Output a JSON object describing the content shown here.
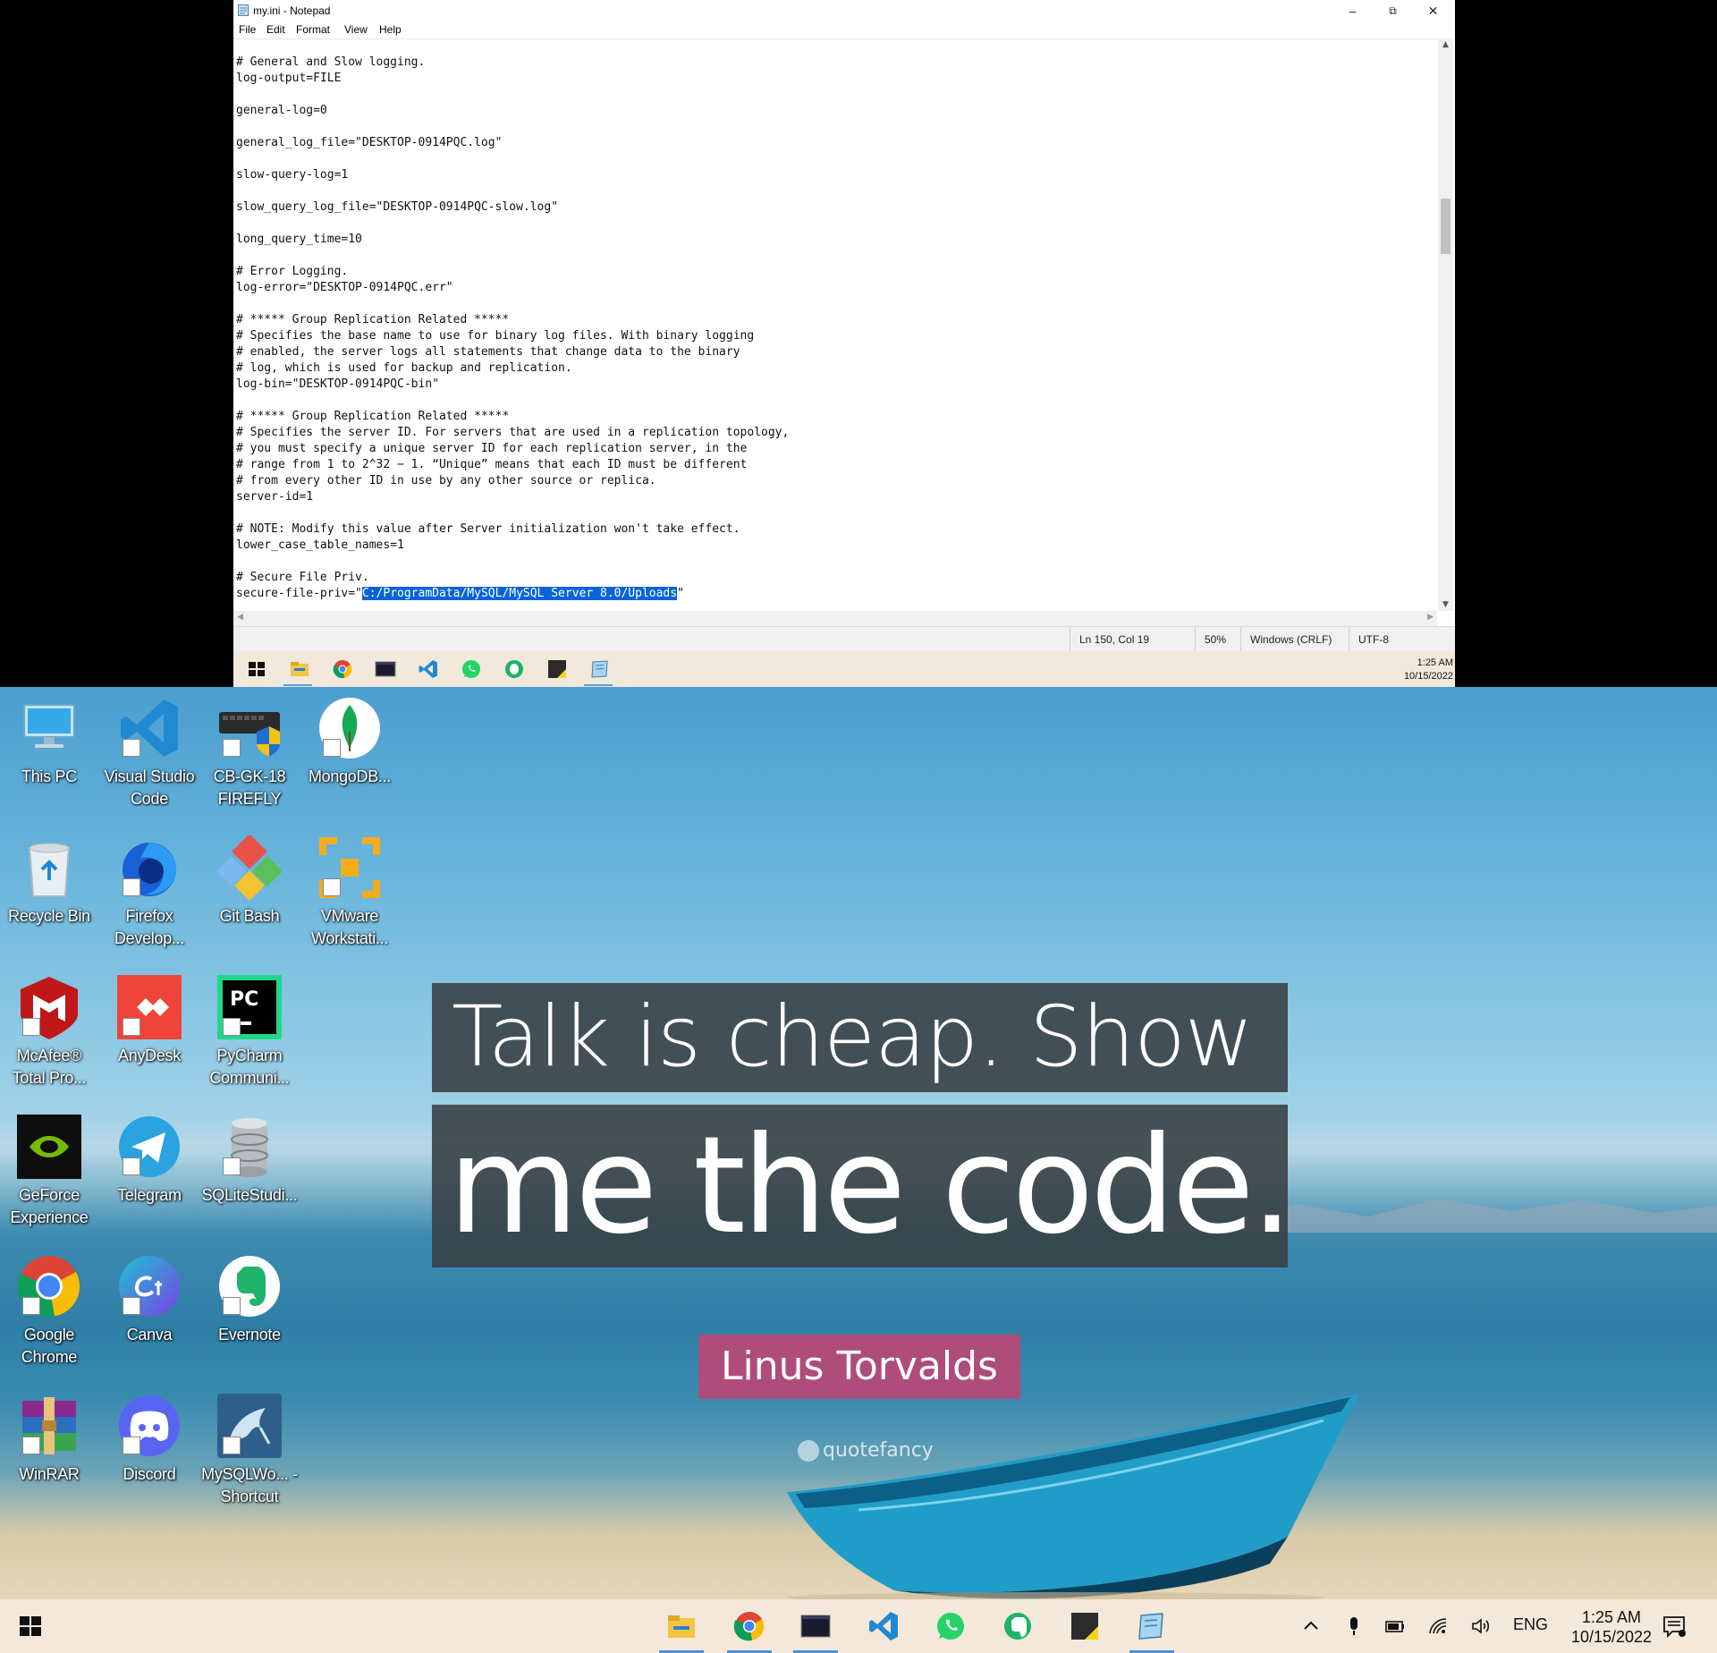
{
  "notepad": {
    "title": "my.ini - Notepad",
    "menu": [
      "File",
      "Edit",
      "Format",
      "View",
      "Help"
    ],
    "lines": [
      "# General and Slow logging.",
      "log-output=FILE",
      "",
      "general-log=0",
      "",
      "general_log_file=\"DESKTOP-0914PQC.log\"",
      "",
      "slow-query-log=1",
      "",
      "slow_query_log_file=\"DESKTOP-0914PQC-slow.log\"",
      "",
      "long_query_time=10",
      "",
      "# Error Logging.",
      "log-error=\"DESKTOP-0914PQC.err\"",
      "",
      "# ***** Group Replication Related *****",
      "# Specifies the base name to use for binary log files. With binary logging",
      "# enabled, the server logs all statements that change data to the binary",
      "# log, which is used for backup and replication.",
      "log-bin=\"DESKTOP-0914PQC-bin\"",
      "",
      "# ***** Group Replication Related *****",
      "# Specifies the server ID. For servers that are used in a replication topology,",
      "# you must specify a unique server ID for each replication server, in the",
      "# range from 1 to 2^32 − 1. “Unique” means that each ID must be different",
      "# from every other ID in use by any other source or replica.",
      "server-id=1",
      "",
      "# NOTE: Modify this value after Server initialization won't take effect.",
      "lower_case_table_names=1",
      "",
      "# Secure File Priv."
    ],
    "last_line": {
      "prefix": "secure-file-priv=\"",
      "selected": "C:/ProgramData/MySQL/MySQL Server 8.0/Uploads",
      "suffix": "\""
    },
    "status": {
      "position": "Ln 150, Col 19",
      "zoom": "50%",
      "line_ending": "Windows (CRLF)",
      "encoding": "UTF-8"
    },
    "scroll_position": 0.3
  },
  "top_taskbar": {
    "time": "1:25 AM",
    "date": "10/15/2022"
  },
  "desktop_icons": [
    {
      "name": "this-pc",
      "label": "This PC",
      "icon": "computer-icon"
    },
    {
      "name": "visual-studio-code",
      "label": "Visual Studio Code",
      "icon": "vscode-icon"
    },
    {
      "name": "cb-gk-18-firefly",
      "label": "CB-GK-18 FIREFLY",
      "icon": "keyboard-icon"
    },
    {
      "name": "mongodb",
      "label": "MongoDB...",
      "icon": "mongodb-leaf-icon"
    },
    {
      "name": "recycle-bin",
      "label": "Recycle Bin",
      "icon": "recycle-bin-icon"
    },
    {
      "name": "firefox-developer",
      "label": "Firefox Develop...",
      "icon": "firefox-icon"
    },
    {
      "name": "git-bash",
      "label": "Git Bash",
      "icon": "git-icon"
    },
    {
      "name": "vmware-workstation",
      "label": "VMware Workstati...",
      "icon": "vmware-icon"
    },
    {
      "name": "mcafee",
      "label": "McAfee® Total Pro...",
      "icon": "mcafee-icon"
    },
    {
      "name": "anydesk",
      "label": "AnyDesk",
      "icon": "anydesk-icon"
    },
    {
      "name": "pycharm",
      "label": "PyCharm Communi...",
      "icon": "pycharm-icon"
    },
    {
      "name": "geforce-experience",
      "label": "GeForce Experience",
      "icon": "nvidia-icon"
    },
    {
      "name": "telegram",
      "label": "Telegram",
      "icon": "telegram-icon"
    },
    {
      "name": "sqlitestudio",
      "label": "SQLiteStudi...",
      "icon": "database-icon"
    },
    {
      "name": "google-chrome",
      "label": "Google Chrome",
      "icon": "chrome-icon"
    },
    {
      "name": "canva",
      "label": "Canva",
      "icon": "canva-icon"
    },
    {
      "name": "evernote",
      "label": "Evernote",
      "icon": "evernote-icon"
    },
    {
      "name": "winrar",
      "label": "WinRAR",
      "icon": "winrar-icon"
    },
    {
      "name": "discord",
      "label": "Discord",
      "icon": "discord-icon"
    },
    {
      "name": "mysql-workbench",
      "label": "MySQLWo... - Shortcut",
      "icon": "mysql-dolphin-icon"
    }
  ],
  "wallpaper": {
    "quote_line1": "Talk is cheap. Show",
    "quote_line2": "me the code.",
    "author": "Linus Torvalds",
    "watermark": "quotefancy"
  },
  "taskbar": {
    "apps": [
      "file-explorer",
      "chrome",
      "terminal",
      "vscode",
      "whatsapp",
      "evernote",
      "sticky-notes",
      "notepad"
    ],
    "language": "ENG",
    "time": "1:25 AM",
    "date": "10/15/2022"
  },
  "colors": {
    "selection": "#0a64d6",
    "taskbar": "#f3e8da",
    "quote_box": "#373f42",
    "author_box": "#b84876",
    "active_indicator": "#4a90d9"
  }
}
